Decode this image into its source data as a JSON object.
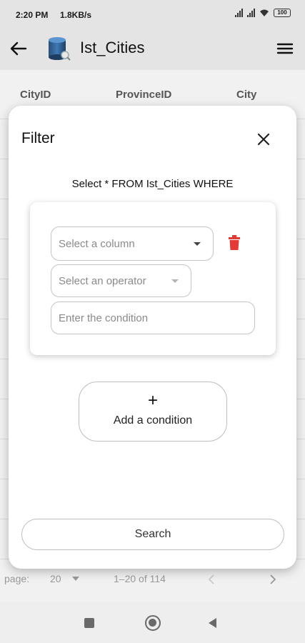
{
  "status_bar": {
    "time": "2:20 PM",
    "speed": "1.8KB/s",
    "battery": "100"
  },
  "app_bar": {
    "title": "Ist_Cities",
    "back_icon": "arrow-left-icon",
    "app_icon": "database-icon",
    "menu_icon": "hamburger-menu-icon"
  },
  "table": {
    "columns": [
      "CityID",
      "ProvinceID",
      "City"
    ]
  },
  "pager": {
    "rows_label": "page:",
    "rows_value": "20",
    "range": "1–20 of 114"
  },
  "dialog": {
    "title": "Filter",
    "query": "Select * FROM Ist_Cities WHERE",
    "column_placeholder": "Select a column",
    "operator_placeholder": "Select an operator",
    "condition_placeholder": "Enter the condition",
    "add_plus": "+",
    "add_label": "Add a condition",
    "search_label": "Search"
  },
  "colors": {
    "delete": "#e53935",
    "dialog_bg": "#ffffff",
    "scrim": "#e9e9e9"
  }
}
